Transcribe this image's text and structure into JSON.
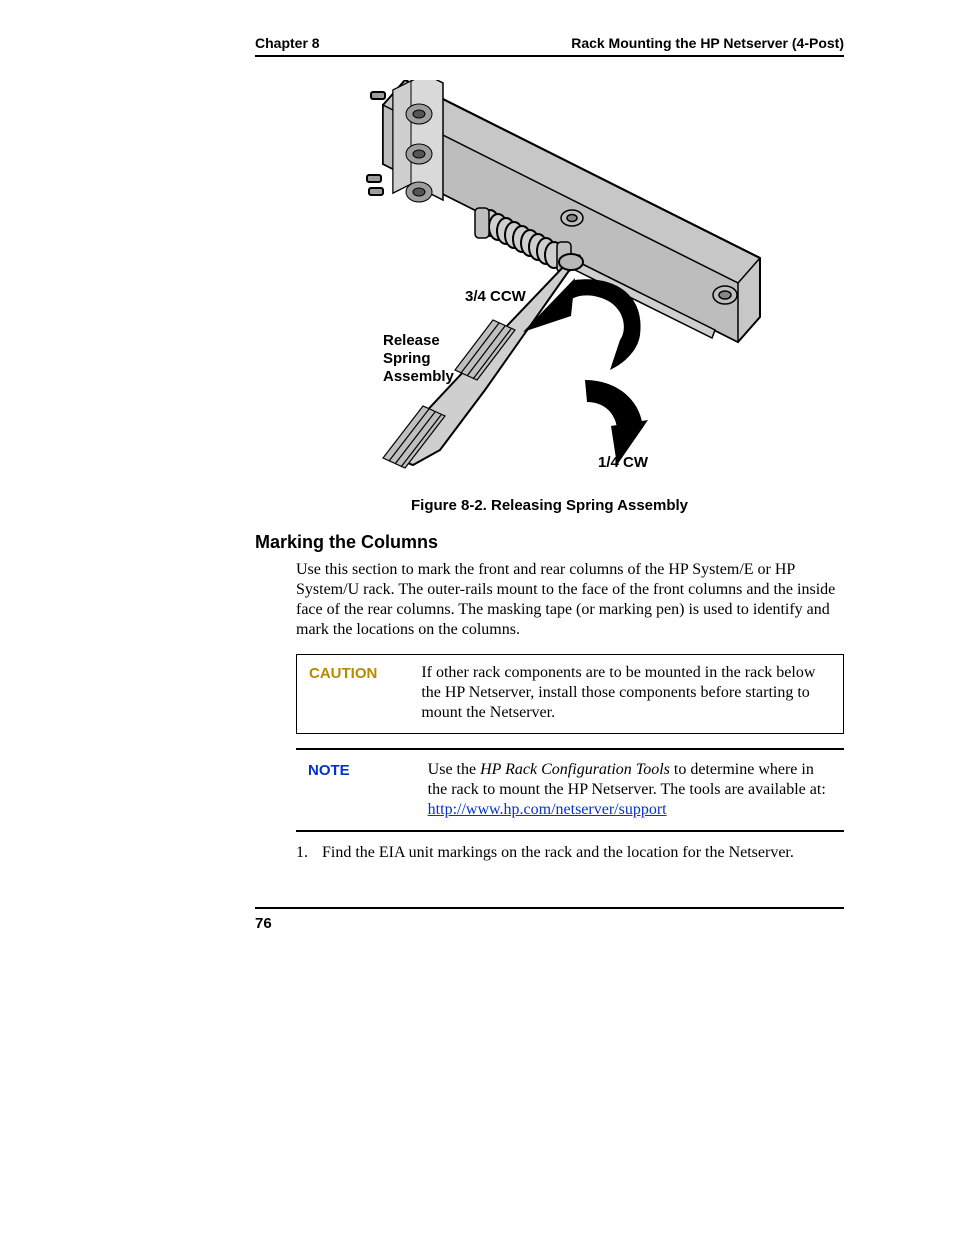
{
  "header": {
    "left": "Chapter 8",
    "right": "Rack Mounting the HP Netserver (4-Post)"
  },
  "figure": {
    "label_ccw": "3/4 CCW",
    "label_release_l1": "Release",
    "label_release_l2": "Spring",
    "label_release_l3": "Assembly",
    "label_cw": "1/4 CW",
    "caption": "Figure 8-2. Releasing Spring Assembly"
  },
  "section": {
    "heading": "Marking the Columns",
    "para": "Use this section to mark the front and rear columns of the HP System/E or HP System/U rack. The outer-rails mount to the face of the front columns and the inside face of the rear columns. The masking tape (or marking pen) is used to identify and mark the locations on the columns."
  },
  "caution": {
    "label": "CAUTION",
    "text": "If other rack components are to be mounted in the rack below the HP Netserver, install those components before starting to mount the Netserver."
  },
  "note": {
    "label": "NOTE",
    "pre": "Use the ",
    "italic": "HP Rack Configuration Tools",
    "post": " to determine where in the rack to mount the HP Netserver. The tools are available at:",
    "link_text": "http://www.hp.com/netserver/support",
    "link_href": "http://www.hp.com/netserver/support"
  },
  "list": {
    "item1_num": "1.",
    "item1_text": "Find the EIA unit markings on the rack and the location for the Netserver."
  },
  "footer": {
    "page": "76"
  }
}
